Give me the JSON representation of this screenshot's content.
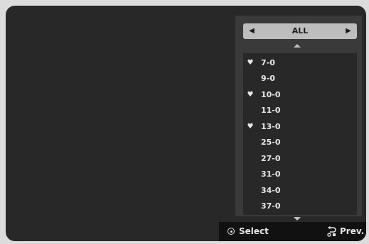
{
  "selector": {
    "value": "ALL",
    "left_arrow_icon": "triangle-left-icon",
    "right_arrow_icon": "triangle-right-icon"
  },
  "channels": [
    {
      "number": "7-0",
      "favorite": true
    },
    {
      "number": "9-0",
      "favorite": false
    },
    {
      "number": "10-0",
      "favorite": true
    },
    {
      "number": "11-0",
      "favorite": false
    },
    {
      "number": "13-0",
      "favorite": true
    },
    {
      "number": "25-0",
      "favorite": false
    },
    {
      "number": "27-0",
      "favorite": false
    },
    {
      "number": "31-0",
      "favorite": false
    },
    {
      "number": "34-0",
      "favorite": false
    },
    {
      "number": "37-0",
      "favorite": false
    }
  ],
  "footer": {
    "select_label": "Select",
    "select_icon": "enter-button-icon",
    "prev_label": "Prev.",
    "prev_icon": "return-icon"
  },
  "colors": {
    "screen_bg": "#282828",
    "panel_bg": "#3a3a3a",
    "selector_bg": "#bdbdbd",
    "footer_bg": "#111111",
    "text": "#e8e8e8"
  }
}
